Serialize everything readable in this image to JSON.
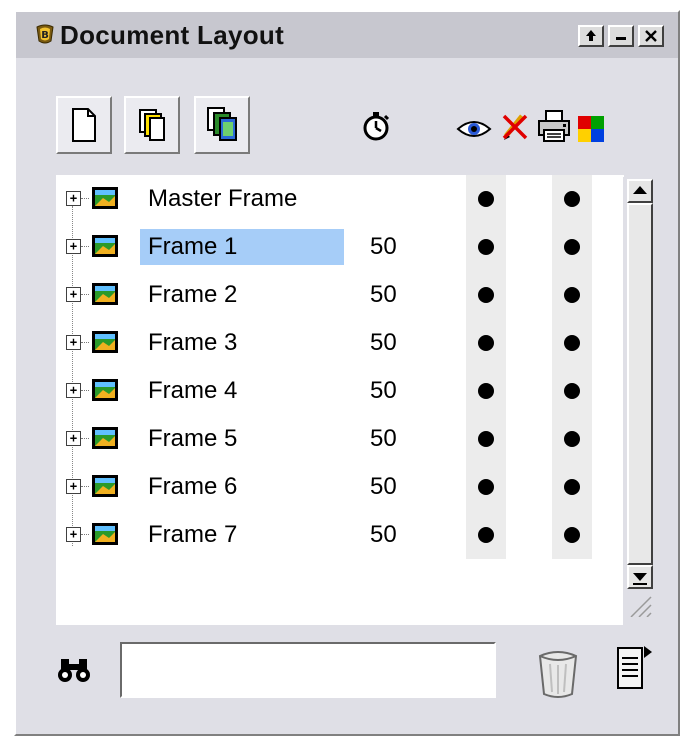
{
  "window": {
    "title": "Document Layout",
    "controls": [
      "up-arrow",
      "minimize",
      "close"
    ]
  },
  "toolbar": {
    "buttons": [
      {
        "name": "new-frame",
        "icon": "new-page-icon"
      },
      {
        "name": "duplicate-frame",
        "icon": "duplicate-icon"
      },
      {
        "name": "insert-from-file",
        "icon": "insert-pages-icon"
      }
    ]
  },
  "column_headers": {
    "delay": "stopwatch-icon",
    "visible": "eye-icon",
    "locked": "pen-lock-icon",
    "printable": "printer-icon",
    "color": "color-swatch-icon"
  },
  "frames": [
    {
      "label": "Master Frame",
      "delay": "",
      "visible": true,
      "printable": true,
      "selected": false
    },
    {
      "label": "Frame 1",
      "delay": "50",
      "visible": true,
      "printable": true,
      "selected": true
    },
    {
      "label": "Frame 2",
      "delay": "50",
      "visible": true,
      "printable": true,
      "selected": false
    },
    {
      "label": "Frame 3",
      "delay": "50",
      "visible": true,
      "printable": true,
      "selected": false
    },
    {
      "label": "Frame 4",
      "delay": "50",
      "visible": true,
      "printable": true,
      "selected": false
    },
    {
      "label": "Frame 5",
      "delay": "50",
      "visible": true,
      "printable": true,
      "selected": false
    },
    {
      "label": "Frame 6",
      "delay": "50",
      "visible": true,
      "printable": true,
      "selected": false
    },
    {
      "label": "Frame 7",
      "delay": "50",
      "visible": true,
      "printable": true,
      "selected": false
    }
  ],
  "search": {
    "value": "",
    "icon": "binoculars-icon"
  },
  "footer": {
    "trash_icon": "trash-icon",
    "menu_icon": "panel-menu-icon"
  },
  "colors": {
    "selection": "#a6cdf8",
    "panel": "#dfdfe6",
    "titlebar": "#c7c7cf"
  }
}
